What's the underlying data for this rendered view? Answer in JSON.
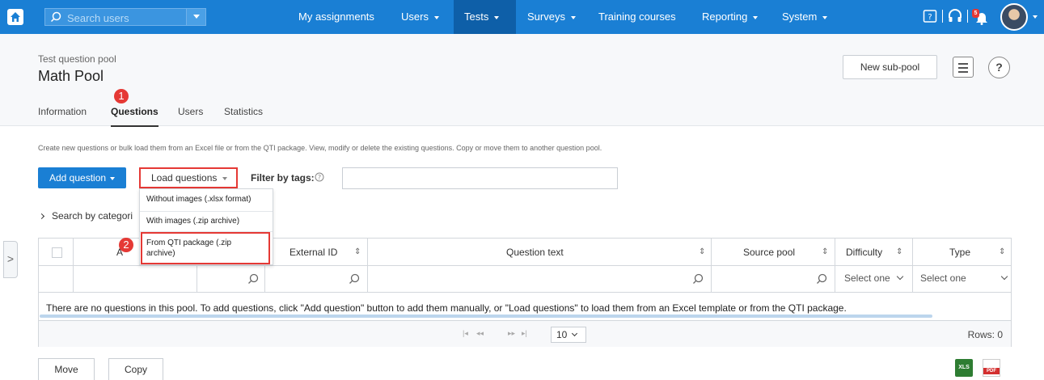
{
  "topnav": {
    "search_placeholder": "Search users",
    "items": [
      {
        "label": "My assignments"
      },
      {
        "label": "Users"
      },
      {
        "label": "Tests"
      },
      {
        "label": "Surveys"
      },
      {
        "label": "Training courses"
      },
      {
        "label": "Reporting"
      },
      {
        "label": "System"
      }
    ],
    "notification_count": "5",
    "accent_color": "#1a7fd4",
    "active_color": "#0e5fa8"
  },
  "header": {
    "subtitle": "Test question pool",
    "title": "Math Pool",
    "new_subpool_label": "New sub-pool",
    "help_label": "?",
    "tabs": [
      {
        "label": "Information"
      },
      {
        "label": "Questions"
      },
      {
        "label": "Users"
      },
      {
        "label": "Statistics"
      }
    ]
  },
  "markers": {
    "first": "1",
    "second": "2",
    "color": "#e53935"
  },
  "content": {
    "description": "Create new questions or bulk load them from an Excel file or from the QTI package. View, modify or delete the existing questions. Copy or move them to another question pool.",
    "add_question_label": "Add question",
    "load_questions_label": "Load questions",
    "filter_by_tags_label": "Filter by tags:",
    "search_by_category_label": "Search by categori",
    "side_tab_label": ">"
  },
  "dropdown": {
    "items": [
      {
        "label": "Without images (.xlsx format)"
      },
      {
        "label": "With images (.zip archive)"
      },
      {
        "label_line1": "From QTI package (.zip",
        "label_line2": "archive)"
      }
    ]
  },
  "table": {
    "columns": [
      {
        "label": "A"
      },
      {
        "label": "External ID"
      },
      {
        "label": "Question text"
      },
      {
        "label": "Source pool"
      },
      {
        "label": "Difficulty"
      },
      {
        "label": "Type"
      }
    ],
    "difficulty_filter": "Select one",
    "type_filter": "Select one",
    "empty_message": "There are no questions in this pool. To add questions, click \"Add question\" button to add them manually, or \"Load questions\" to load them from an Excel template or from the QTI package.",
    "page_size": "10",
    "rows_label": "Rows: 0"
  },
  "actions": {
    "move_label": "Move",
    "copy_label": "Copy",
    "xls_label": "XLS",
    "pdf_label": "PDF"
  }
}
